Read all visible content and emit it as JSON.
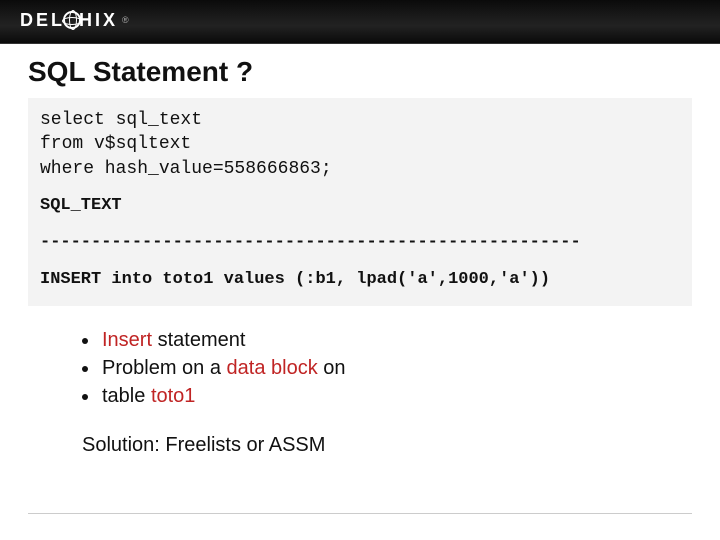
{
  "logo": {
    "pre": "DEL",
    "post": "HIX",
    "reg": "®"
  },
  "title": "SQL Statement ?",
  "code": {
    "line1": "select sql_text",
    "line2": "from v$sqltext",
    "line3": "where hash_value=558666863;",
    "result_header": "SQL_TEXT",
    "result_sep": "-----------------------------------------------------",
    "result_line": "INSERT into toto1 values (:b1, lpad('a',1000,'a'))"
  },
  "bullets": {
    "b1a": "Insert",
    "b1b": " statement",
    "b2a": "Problem on a ",
    "b2b": "data block",
    "b2c": " on",
    "b3a": "table ",
    "b3b": "toto1"
  },
  "solution": "Solution: Freelists or ASSM"
}
